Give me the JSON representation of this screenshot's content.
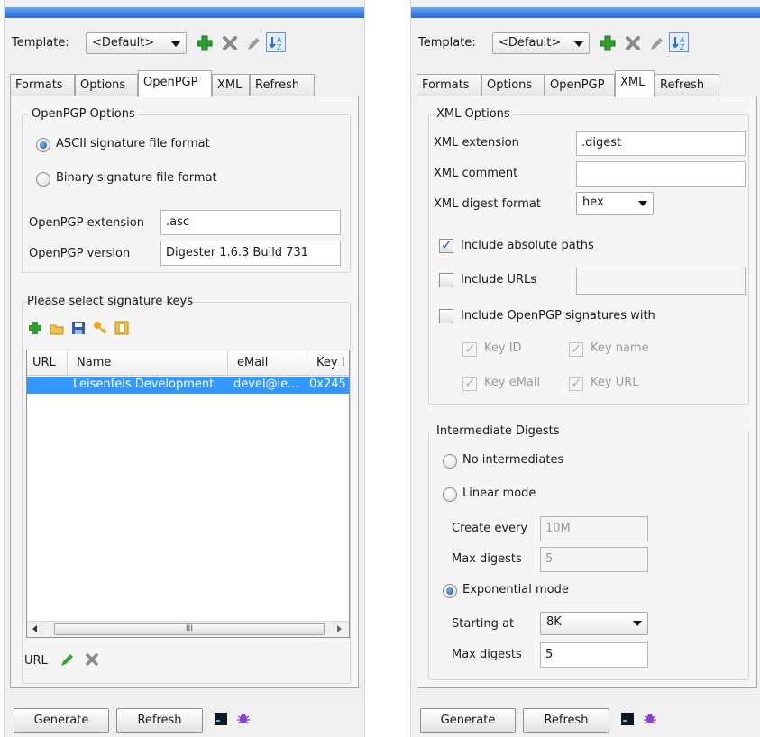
{
  "left": {
    "template_label": "Template:",
    "template_value": "<Default>",
    "tabs": [
      "Formats",
      "Options",
      "OpenPGP",
      "XML",
      "Refresh"
    ],
    "active_tab": "OpenPGP",
    "openpgp_group_title": "OpenPGP Options",
    "radio_ascii": "ASCII signature file format",
    "radio_binary": "Binary signature file format",
    "extension_label": "OpenPGP extension",
    "extension_value": ".asc",
    "version_label": "OpenPGP version",
    "version_value": "Digester 1.6.3 Build 731",
    "keys_group_title": "Please select signature keys",
    "table_headers": [
      "URL",
      "Name",
      "eMail",
      "Key I"
    ],
    "table_rows": [
      {
        "url": "",
        "name": "Leisenfels Development",
        "email": "devel@le...",
        "key": "0x245"
      }
    ],
    "scroll_thumb": "III",
    "url_label": "URL",
    "generate_label": "Generate",
    "refresh_label": "Refresh"
  },
  "right": {
    "template_label": "Template:",
    "template_value": "<Default>",
    "tabs": [
      "Formats",
      "Options",
      "OpenPGP",
      "XML",
      "Refresh"
    ],
    "active_tab": "XML",
    "xml_group_title": "XML Options",
    "xml_extension_label": "XML extension",
    "xml_extension_value": ".digest",
    "xml_comment_label": "XML comment",
    "xml_comment_value": "",
    "xml_digest_label": "XML digest format",
    "xml_digest_value": "hex",
    "include_abs_paths": "Include absolute paths",
    "include_urls": "Include URLs",
    "include_openpgp": "Include OpenPGP signatures with",
    "key_id": "Key ID",
    "key_name": "Key name",
    "key_email": "Key eMail",
    "key_url": "Key URL",
    "intermediate_title": "Intermediate Digests",
    "no_intermediates": "No intermediates",
    "linear_mode": "Linear mode",
    "create_every_label": "Create every",
    "create_every_value": "10M",
    "max_digests_label": "Max digests",
    "max_digests_linear_value": "5",
    "exponential_mode": "Exponential mode",
    "starting_at_label": "Starting at",
    "starting_at_value": "8K",
    "max_digests_exp_value": "5",
    "generate_label": "Generate",
    "refresh_label": "Refresh"
  },
  "colors": {
    "title_bar": "#3c7fe0",
    "selection": "#3399ff",
    "add_icon": "#2e9e2e",
    "delete_icon": "#8a8a8a"
  }
}
